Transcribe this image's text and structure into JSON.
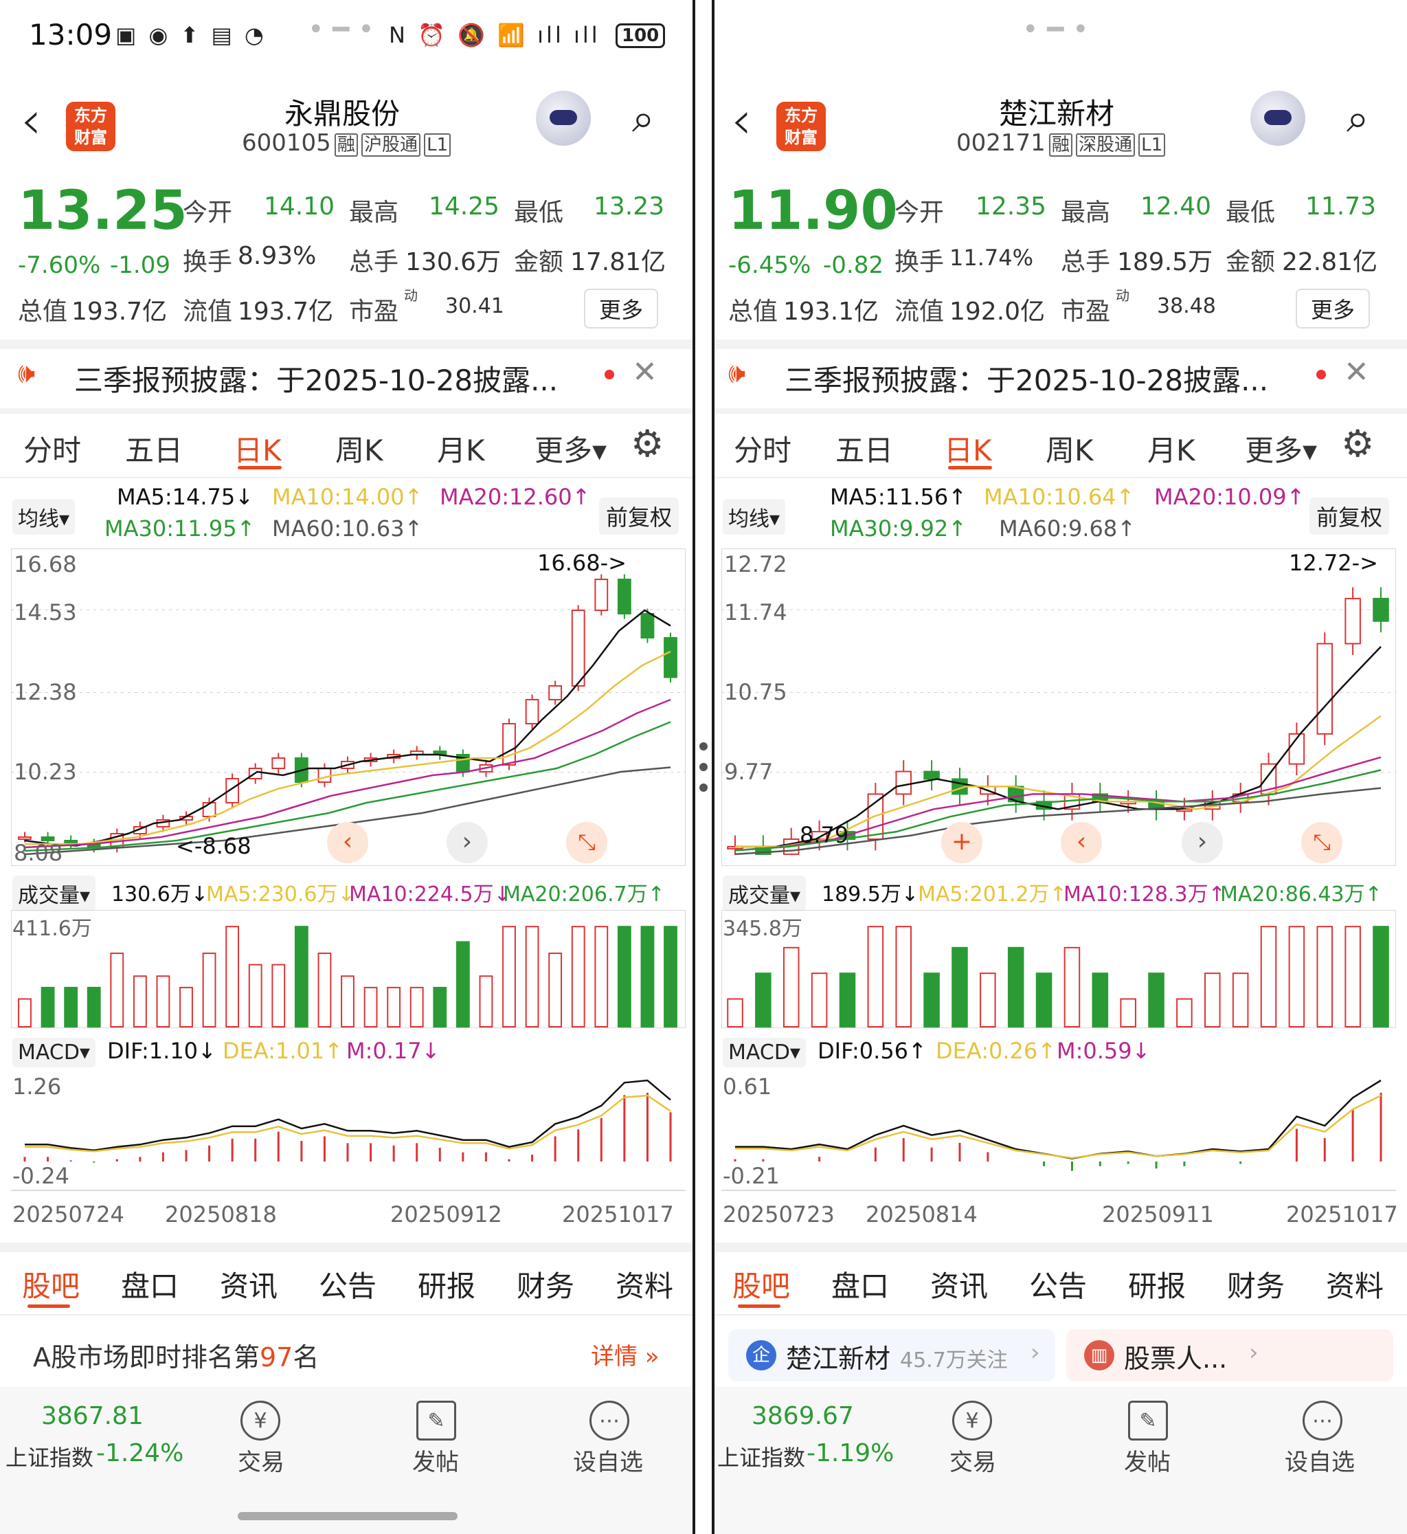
{
  "status_bar": {
    "time": "13:09",
    "battery": "100"
  },
  "left": {
    "stock_name": "永鼎股份",
    "code": "600105",
    "tags": [
      "融",
      "沪股通",
      "L1"
    ],
    "logo_text": [
      "东方",
      "财富"
    ],
    "price": "13.25",
    "change_pct": "-7.60%",
    "change": "-1.09",
    "open_label": "今开",
    "open": "14.10",
    "high_label": "最高",
    "high": "14.25",
    "low_label": "最低",
    "low": "13.23",
    "turnover_label": "换手",
    "turnover": "8.93%",
    "volume_label": "总手",
    "volume": "130.6万",
    "amount_label": "金额",
    "amount": "17.81亿",
    "mktcap_label": "总值",
    "mktcap": "193.7亿",
    "float_label": "流值",
    "float": "193.7亿",
    "pe_label": "市盈",
    "pe_sup": "动",
    "pe": "30.41",
    "more_label": "更多",
    "notice": "三季报预披露：于2025-10-28披露...",
    "chart_tabs": [
      "分时",
      "五日",
      "日K",
      "周K",
      "月K",
      "更多▾"
    ],
    "active_tab": "日K",
    "ma_select": "均线▾",
    "ma5": "MA5:14.75↓",
    "ma10": "MA10:14.00↑",
    "ma20": "MA20:12.60↑",
    "ma30": "MA30:11.95↑",
    "ma60": "MA60:10.63↑",
    "adjust": "前复权",
    "y_labels": [
      "16.68",
      "14.53",
      "12.38",
      "10.23",
      "8.08"
    ],
    "max_marker": "16.68->",
    "min_marker": "<-8.68",
    "vol_select": "成交量▾",
    "vol_now": "130.6万↓",
    "vol_ma5": "MA5:230.6万↓",
    "vol_ma10": "MA10:224.5万↓",
    "vol_ma20": "MA20:206.7万↑",
    "vol_max": "411.6万",
    "macd_select": "MACD▾",
    "dif": "DIF:1.10↓",
    "dea": "DEA:1.01↑",
    "m": "M:0.17↓",
    "macd_top": "1.26",
    "macd_bottom": "-0.24",
    "dates": [
      "20250724",
      "20250818",
      "20250912",
      "20251017"
    ],
    "bottom_tabs": [
      "股吧",
      "盘口",
      "资讯",
      "公告",
      "研报",
      "财务",
      "资料"
    ],
    "rank_prefix": "A股市场即时排名第",
    "rank_num": "97",
    "rank_suffix": "名",
    "detail": "详情 »",
    "index_value": "3867.81",
    "index_label": "上证指数",
    "index_change": "-1.24%",
    "actions": [
      "交易",
      "发帖",
      "设自选"
    ]
  },
  "right": {
    "stock_name": "楚江新材",
    "code": "002171",
    "tags": [
      "融",
      "深股通",
      "L1"
    ],
    "logo_text": [
      "东方",
      "财富"
    ],
    "price": "11.90",
    "change_pct": "-6.45%",
    "change": "-0.82",
    "open_label": "今开",
    "open": "12.35",
    "high_label": "最高",
    "high": "12.40",
    "low_label": "最低",
    "low": "11.73",
    "turnover_label": "换手",
    "turnover": "11.74%",
    "volume_label": "总手",
    "volume": "189.5万",
    "amount_label": "金额",
    "amount": "22.81亿",
    "mktcap_label": "总值",
    "mktcap": "193.1亿",
    "float_label": "流值",
    "float": "192.0亿",
    "pe_label": "市盈",
    "pe_sup": "动",
    "pe": "38.48",
    "more_label": "更多",
    "notice": "三季报预披露：于2025-10-28披露...",
    "chart_tabs": [
      "分时",
      "五日",
      "日K",
      "周K",
      "月K",
      "更多▾"
    ],
    "active_tab": "日K",
    "ma_select": "均线▾",
    "ma5": "MA5:11.56↑",
    "ma10": "MA10:10.64↑",
    "ma20": "MA20:10.09↑",
    "ma30": "MA30:9.92↑",
    "ma60": "MA60:9.68↑",
    "adjust": "前复权",
    "y_labels": [
      "12.72",
      "11.74",
      "10.75",
      "9.77",
      "8.79"
    ],
    "max_marker": "12.72->",
    "min_marker": "8.79",
    "vol_select": "成交量▾",
    "vol_now": "189.5万↓",
    "vol_ma5": "MA5:201.2万↑",
    "vol_ma10": "MA10:128.3万↑",
    "vol_ma20": "MA20:86.43万↑",
    "vol_max": "345.8万",
    "macd_select": "MACD▾",
    "dif": "DIF:0.56↑",
    "dea": "DEA:0.26↑",
    "m": "M:0.59↓",
    "macd_top": "0.61",
    "macd_bottom": "-0.21",
    "dates": [
      "20250723",
      "20250814",
      "20250911",
      "20251017"
    ],
    "bottom_tabs": [
      "股吧",
      "盘口",
      "资讯",
      "公告",
      "研报",
      "财务",
      "资料"
    ],
    "card1_icon": "企",
    "card1_title": "楚江新材",
    "card1_sub": "45.7万关注",
    "card2_title": "股票人...",
    "index_value": "3869.67",
    "index_label": "上证指数",
    "index_change": "-1.19%",
    "actions": [
      "交易",
      "发帖",
      "设自选"
    ]
  },
  "colors": {
    "up": "#d33",
    "down": "#2a9b34",
    "accent": "#e8491d",
    "ma5": "#111111",
    "ma10": "#e8c23a",
    "ma20": "#b9268f",
    "ma30": "#2a9b34",
    "ma60": "#555555"
  },
  "chart_data": [
    {
      "type": "candlestick",
      "title": "永鼎股份 日K",
      "x": [
        "20250724",
        "20250818",
        "20250912",
        "20251017"
      ],
      "ylim": [
        8.08,
        16.68
      ],
      "values": [
        8.6,
        8.5,
        8.4,
        8.3,
        8.7,
        8.9,
        9.1,
        9.2,
        9.6,
        10.3,
        10.6,
        10.9,
        10.2,
        10.6,
        10.8,
        10.9,
        11.0,
        11.1,
        11.0,
        10.5,
        10.7,
        11.9,
        12.6,
        13.0,
        15.2,
        16.1,
        15.1,
        14.4,
        13.25
      ],
      "series": [
        {
          "name": "MA5",
          "values": [
            8.5,
            8.4,
            8.35,
            8.5,
            8.7,
            9.0,
            9.1,
            9.5,
            10.0,
            10.5,
            10.4,
            10.6,
            10.6,
            10.8,
            10.9,
            11.0,
            11.0,
            10.9,
            10.8,
            11.2,
            12.0,
            12.7,
            13.6,
            14.6,
            15.2,
            14.75
          ]
        },
        {
          "name": "MA10",
          "values": [
            8.4,
            8.4,
            8.4,
            8.5,
            8.6,
            8.8,
            9.0,
            9.3,
            9.7,
            10.0,
            10.2,
            10.4,
            10.5,
            10.6,
            10.7,
            10.8,
            10.9,
            10.9,
            11.2,
            11.7,
            12.3,
            13.0,
            13.6,
            14.0
          ]
        },
        {
          "name": "MA20",
          "values": [
            8.3,
            8.35,
            8.4,
            8.5,
            8.6,
            8.8,
            9.0,
            9.2,
            9.5,
            9.8,
            10.0,
            10.2,
            10.4,
            10.5,
            10.7,
            10.9,
            11.3,
            11.7,
            12.2,
            12.6
          ]
        },
        {
          "name": "MA30",
          "values": [
            8.2,
            8.25,
            8.3,
            8.4,
            8.5,
            8.7,
            8.9,
            9.1,
            9.3,
            9.6,
            9.8,
            10.0,
            10.2,
            10.4,
            10.6,
            11.0,
            11.5,
            11.95
          ]
        },
        {
          "name": "MA60",
          "values": [
            8.1,
            8.2,
            8.3,
            8.4,
            8.5,
            8.7,
            8.9,
            9.1,
            9.3,
            9.6,
            9.9,
            10.2,
            10.5,
            10.63
          ]
        }
      ]
    },
    {
      "type": "candlestick",
      "title": "楚江新材 日K",
      "x": [
        "20250723",
        "20250814",
        "20250911",
        "20251017"
      ],
      "ylim": [
        8.79,
        12.72
      ],
      "values": [
        8.9,
        8.8,
        9.0,
        9.1,
        9.0,
        9.6,
        9.9,
        9.8,
        9.6,
        9.7,
        9.5,
        9.4,
        9.6,
        9.5,
        9.5,
        9.4,
        9.4,
        9.5,
        9.6,
        10.0,
        10.4,
        11.6,
        12.2,
        11.9
      ],
      "series": [
        {
          "name": "MA5",
          "values": [
            8.9,
            8.9,
            9.0,
            9.3,
            9.7,
            9.8,
            9.7,
            9.5,
            9.4,
            9.5,
            9.4,
            9.4,
            9.5,
            9.7,
            10.4,
            11.0,
            11.56
          ]
        },
        {
          "name": "MA10",
          "values": [
            8.9,
            8.9,
            9.0,
            9.3,
            9.5,
            9.7,
            9.7,
            9.6,
            9.5,
            9.5,
            9.4,
            9.5,
            9.7,
            10.2,
            10.64
          ]
        },
        {
          "name": "MA20",
          "values": [
            8.85,
            8.9,
            9.0,
            9.2,
            9.4,
            9.5,
            9.6,
            9.6,
            9.55,
            9.5,
            9.55,
            9.7,
            9.9,
            10.09
          ]
        },
        {
          "name": "MA30",
          "values": [
            8.85,
            8.9,
            9.0,
            9.1,
            9.3,
            9.45,
            9.5,
            9.55,
            9.5,
            9.5,
            9.6,
            9.75,
            9.92
          ]
        },
        {
          "name": "MA60",
          "values": [
            8.8,
            8.85,
            8.95,
            9.05,
            9.2,
            9.3,
            9.35,
            9.4,
            9.45,
            9.5,
            9.6,
            9.68
          ]
        }
      ]
    }
  ]
}
